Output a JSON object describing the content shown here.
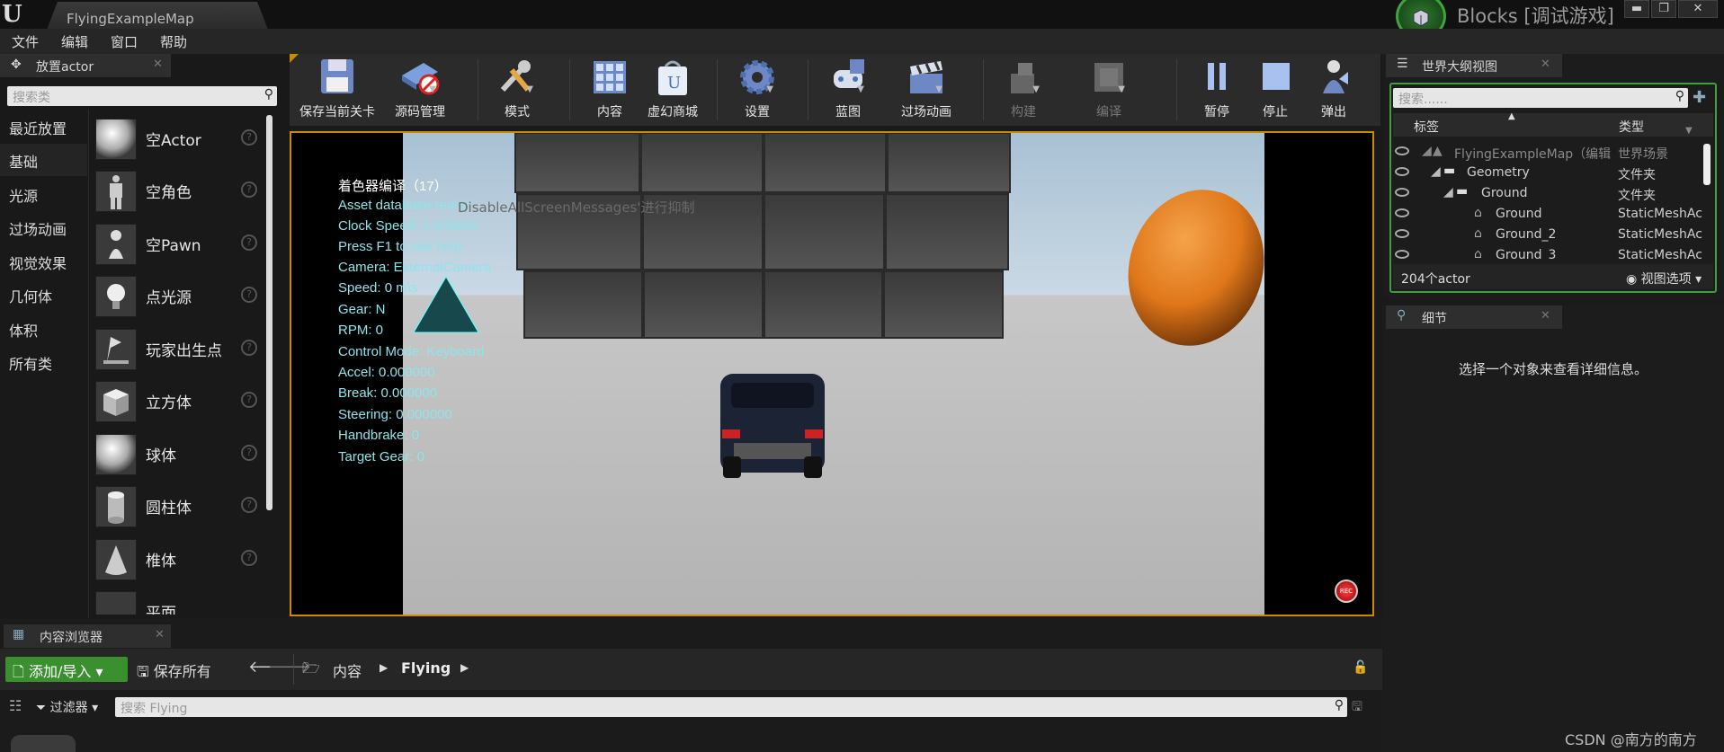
{
  "titlebar": {
    "map_tab": "FlyingExampleMap",
    "project_title": "Blocks [调试游戏]",
    "min_label": "▬",
    "max_label": "❐",
    "close_label": "✕"
  },
  "menu": {
    "items": [
      "文件",
      "编辑",
      "窗口",
      "帮助"
    ]
  },
  "place_panel": {
    "tab_label": "放置actor",
    "search_placeholder": "搜索类",
    "categories": [
      "最近放置",
      "基础",
      "光源",
      "过场动画",
      "视觉效果",
      "几何体",
      "体积",
      "所有类"
    ],
    "active_category": "基础",
    "items": [
      "空Actor",
      "空角色",
      "空Pawn",
      "点光源",
      "玩家出生点",
      "立方体",
      "球体",
      "圆柱体",
      "椎体",
      "平面"
    ]
  },
  "toolbar": {
    "buttons": [
      "保存当前关卡",
      "源码管理",
      "模式",
      "内容",
      "虚幻商城",
      "设置",
      "蓝图",
      "过场动画",
      "构建",
      "编译",
      "暂停",
      "停止",
      "弹出"
    ]
  },
  "viewport": {
    "hud_lines": [
      "着色器编译（17）",
      "Asset database ready!",
      "Clock Speed: 1.000000",
      "Press F1 to see help",
      "Camera: ExternalCamera",
      "Speed: 0 m\\s",
      "Gear: N",
      "RPM: 0",
      "Control Mode: Keyboard",
      "Accel: 0.000000",
      "Break: 0.000000",
      "Steering: 0.000000",
      "Handbrake: 0",
      "Target Gear: 0"
    ],
    "overlay_text": "DisableAllScreenMessages'进行抑制",
    "rec_label": "REC"
  },
  "outliner": {
    "tab_label": "世界大纲视图",
    "search_placeholder": "搜索......",
    "col_label": "标签",
    "col_type": "类型",
    "rows": [
      {
        "label": "FlyingExampleMap（编辑",
        "type": "世界场景"
      },
      {
        "label": "Geometry",
        "type": "文件夹"
      },
      {
        "label": "Ground",
        "type": "文件夹"
      },
      {
        "label": "Ground",
        "type": "StaticMeshAc"
      },
      {
        "label": "Ground_2",
        "type": "StaticMeshAc"
      },
      {
        "label": "Ground_3",
        "type": "StaticMeshAc"
      }
    ],
    "actor_count": "204个actor",
    "view_options": "视图选项"
  },
  "details": {
    "tab_label": "细节",
    "empty_message": "选择一个对象来查看详细信息。"
  },
  "content_browser": {
    "tab_label": "内容浏览器",
    "add_import": "添加/导入",
    "save_all": "保存所有",
    "path": [
      "内容",
      "Flying"
    ],
    "filter_label": "过滤器",
    "search_placeholder": "搜索 Flying"
  },
  "watermark": "CSDN @南方的南方",
  "colors": {
    "accent_orange": "#c98b00",
    "green": "#3a8f2f",
    "hud_text": "#8ee5ea"
  }
}
